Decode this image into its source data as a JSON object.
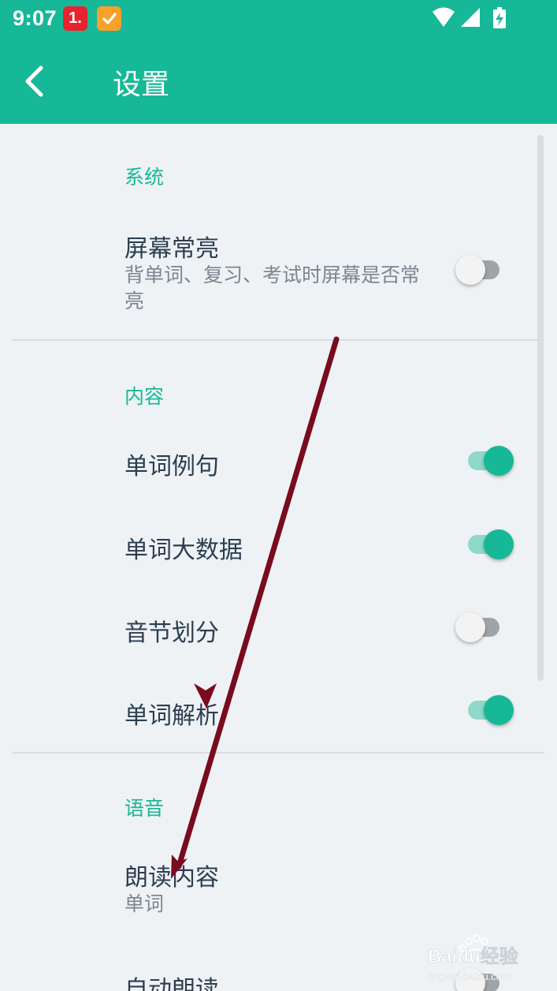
{
  "status_bar": {
    "time": "9:07",
    "badge_1": "1.",
    "icons": [
      "wifi-icon",
      "signal-icon",
      "battery-charging-icon"
    ]
  },
  "app_bar": {
    "title": "设置",
    "back_icon": "chevron-left-icon"
  },
  "sections": [
    {
      "header": "系统",
      "items": [
        {
          "title": "屏幕常亮",
          "subtitle": "背单词、复习、考试时屏幕是否常亮",
          "switch_on": false
        }
      ]
    },
    {
      "header": "内容",
      "items": [
        {
          "title": "单词例句",
          "switch_on": true
        },
        {
          "title": "单词大数据",
          "switch_on": true
        },
        {
          "title": "音节划分",
          "switch_on": false
        },
        {
          "title": "单词解析",
          "switch_on": true
        }
      ]
    },
    {
      "header": "语音",
      "items": [
        {
          "title": "朗读内容",
          "subtitle": "单词"
        },
        {
          "title": "自动朗读",
          "switch_on": false
        }
      ]
    }
  ],
  "colors": {
    "accent": "#17b897",
    "annotation": "#7a0a1e"
  },
  "watermark": {
    "brand": "Baidu经验",
    "url": "jingyan.baidu.com"
  }
}
